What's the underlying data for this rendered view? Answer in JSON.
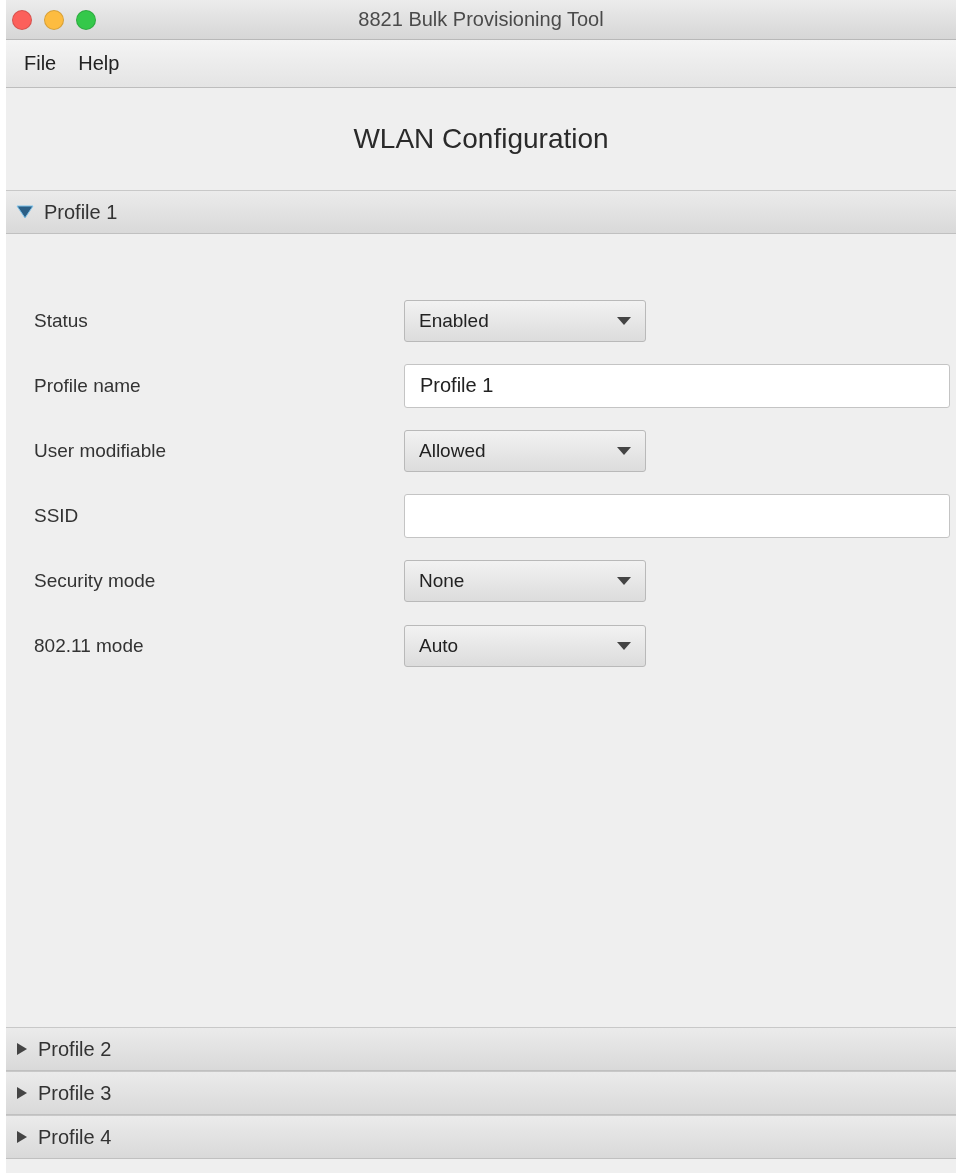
{
  "window": {
    "title": "8821 Bulk Provisioning Tool"
  },
  "menu": [
    "File",
    "Help"
  ],
  "heading": "WLAN Configuration",
  "profiles": [
    {
      "title": "Profile 1",
      "expanded": true,
      "fields": [
        {
          "label": "Status",
          "kind": "select",
          "value": "Enabled"
        },
        {
          "label": "Profile name",
          "kind": "text",
          "value": "Profile 1"
        },
        {
          "label": "User modifiable",
          "kind": "select",
          "value": "Allowed"
        },
        {
          "label": "SSID",
          "kind": "text"
        },
        {
          "label": "Security mode",
          "kind": "select",
          "value": "None"
        },
        {
          "label": "802.11 mode",
          "kind": "select",
          "value": "Auto"
        }
      ]
    },
    {
      "title": "Profile 2",
      "expanded": false
    },
    {
      "title": "Profile 3",
      "expanded": false
    },
    {
      "title": "Profile 4",
      "expanded": false
    }
  ]
}
